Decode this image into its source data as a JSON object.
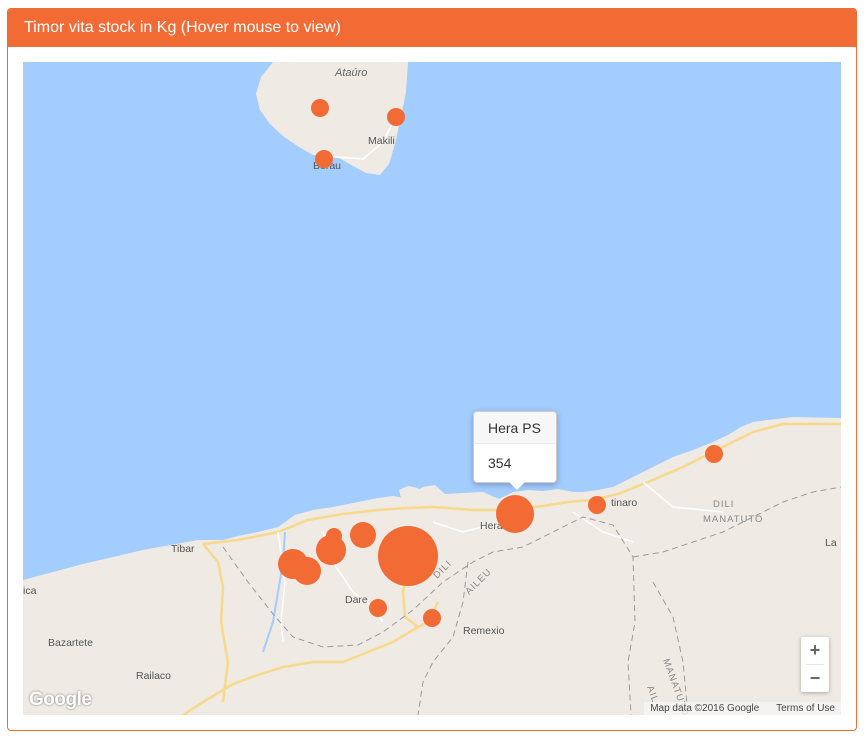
{
  "panel": {
    "title": "Timor vita stock in Kg (Hover mouse to view)"
  },
  "map": {
    "colors": {
      "water": "#a3ccff",
      "land": "#efebe4",
      "road": "#f6d98a",
      "marker": "#f26a34"
    },
    "place_labels": [
      {
        "id": "atauro",
        "text": "Ataúro"
      },
      {
        "id": "makili",
        "text": "Makili"
      },
      {
        "id": "beloi",
        "text": "Berau"
      },
      {
        "id": "tibar",
        "text": "Tibar"
      },
      {
        "id": "dare",
        "text": "Dare"
      },
      {
        "id": "bazartete",
        "text": "Bazartete"
      },
      {
        "id": "railaco",
        "text": "Railaco"
      },
      {
        "id": "remexio",
        "text": "Remexio"
      },
      {
        "id": "hera",
        "text": "Hera"
      },
      {
        "id": "metinaro",
        "text": "tinaro"
      },
      {
        "id": "la",
        "text": "La"
      },
      {
        "id": "liq-edge",
        "text": "ica"
      }
    ],
    "region_labels": [
      {
        "id": "dili",
        "text": "DILI"
      },
      {
        "id": "aileu",
        "text": "AILEU"
      },
      {
        "id": "dili-e",
        "text": "DILI"
      },
      {
        "id": "manatuto-e",
        "text": "MANATUTO"
      },
      {
        "id": "manatuto-s",
        "text": "MANATUTO"
      },
      {
        "id": "ail-s",
        "text": "AIL"
      }
    ],
    "tooltip": {
      "name": "Hera PS",
      "value": "354"
    },
    "attribution": {
      "data": "Map data ©2016 Google",
      "terms": "Terms of Use"
    },
    "logo": "Google",
    "zoom": {
      "in": "+",
      "out": "−"
    }
  }
}
